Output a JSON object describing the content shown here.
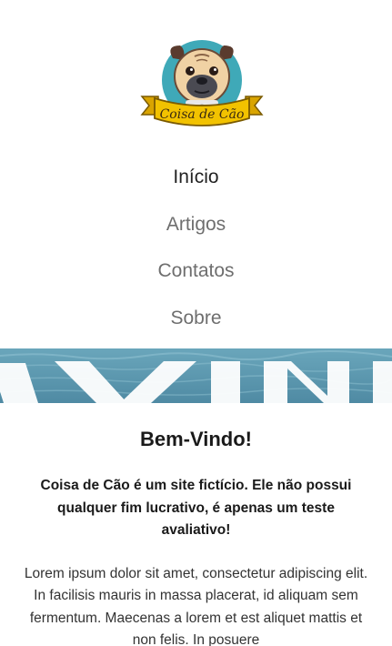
{
  "header": {
    "logo_text": "Coisa de Cão"
  },
  "nav": {
    "items": [
      {
        "label": "Início",
        "active": true
      },
      {
        "label": "Artigos",
        "active": false
      },
      {
        "label": "Contatos",
        "active": false
      },
      {
        "label": "Sobre",
        "active": false
      }
    ]
  },
  "banner": {
    "image": "sea-water-banner",
    "overlay_text": "BEM-VINDO"
  },
  "main": {
    "title": "Bem-Vindo!",
    "subtitle": "Coisa de Cão é um site fictício. Ele não possui qualquer fim lucrativo, é apenas um teste avaliativo!",
    "body": "Lorem ipsum dolor sit amet, consectetur adipiscing elit. In facilisis mauris in massa placerat, id aliquam sem fermentum. Maecenas a lorem et est aliquet mattis et non felis. In posuere"
  },
  "colors": {
    "logo_teal": "#3fa9b8",
    "logo_ribbon": "#f2c200",
    "nav_text": "#6e6e6e",
    "nav_active": "#222222",
    "sea": "#5d98ae"
  }
}
